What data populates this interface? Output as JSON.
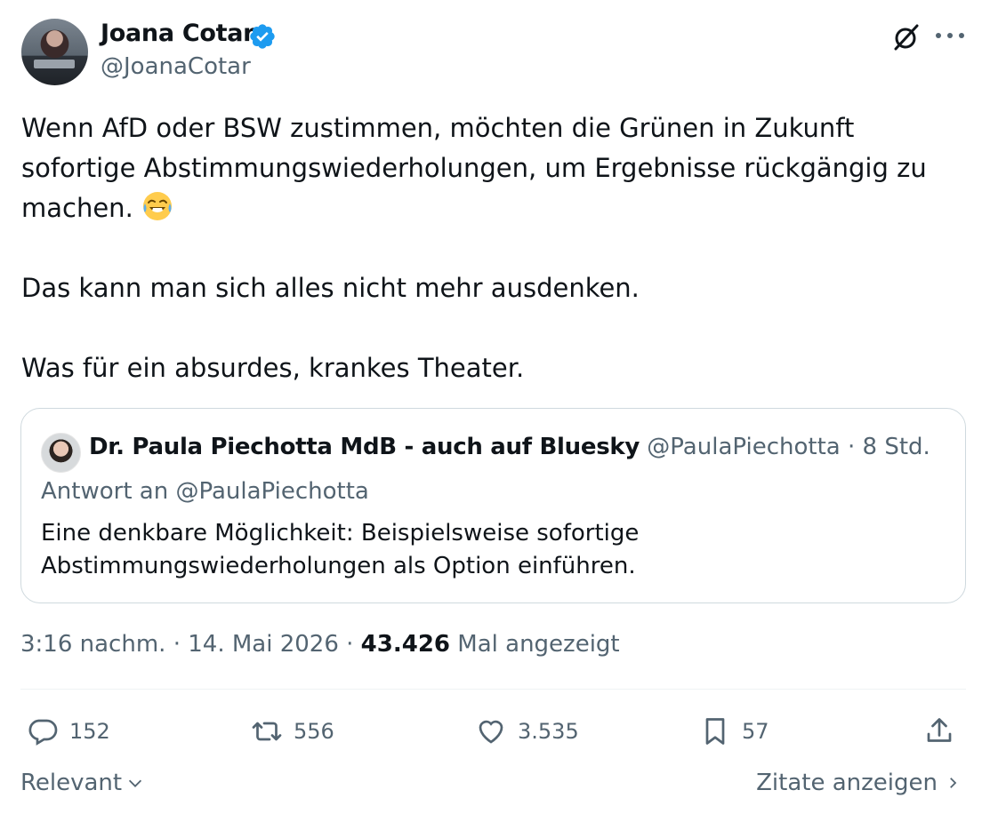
{
  "author": {
    "name": "Joana Cotar",
    "handle": "@JoanaCotar",
    "verified": true
  },
  "tweet": {
    "paragraphs": [
      "Wenn AfD oder BSW zustimmen, möchten die Grünen in Zukunft sofortige Abstimmungswiederholungen, um Ergebnisse rückgängig zu machen.",
      "Das kann man sich alles nicht mehr ausdenken.",
      "Was für ein absurdes, krankes Theater."
    ],
    "emoji": "face-with-tears-of-joy"
  },
  "quote": {
    "name": "Dr. Paula Piechotta MdB - auch auf Bluesky",
    "handle": "@PaulaPiechotta",
    "time": "8 Std.",
    "reply_to": "Antwort an @PaulaPiechotta",
    "text_line1": "Eine denkbare Möglichkeit: Beispielsweise sofortige",
    "text_line2": "Abstimmungswiederholungen als Option einführen."
  },
  "meta": {
    "time": "3:16 nachm.",
    "date": "14. Mai 2026",
    "views": "43.426",
    "views_label": "Mal angezeigt"
  },
  "actions": {
    "replies": "152",
    "reposts": "556",
    "likes": "3.535",
    "bookmarks": "57"
  },
  "footer": {
    "sort_label": "Relevant",
    "quotes_link": "Zitate anzeigen"
  },
  "colors": {
    "text": "#0f1419",
    "secondary": "#536471",
    "verified": "#1d9bf0",
    "border": "#cfd9de"
  }
}
